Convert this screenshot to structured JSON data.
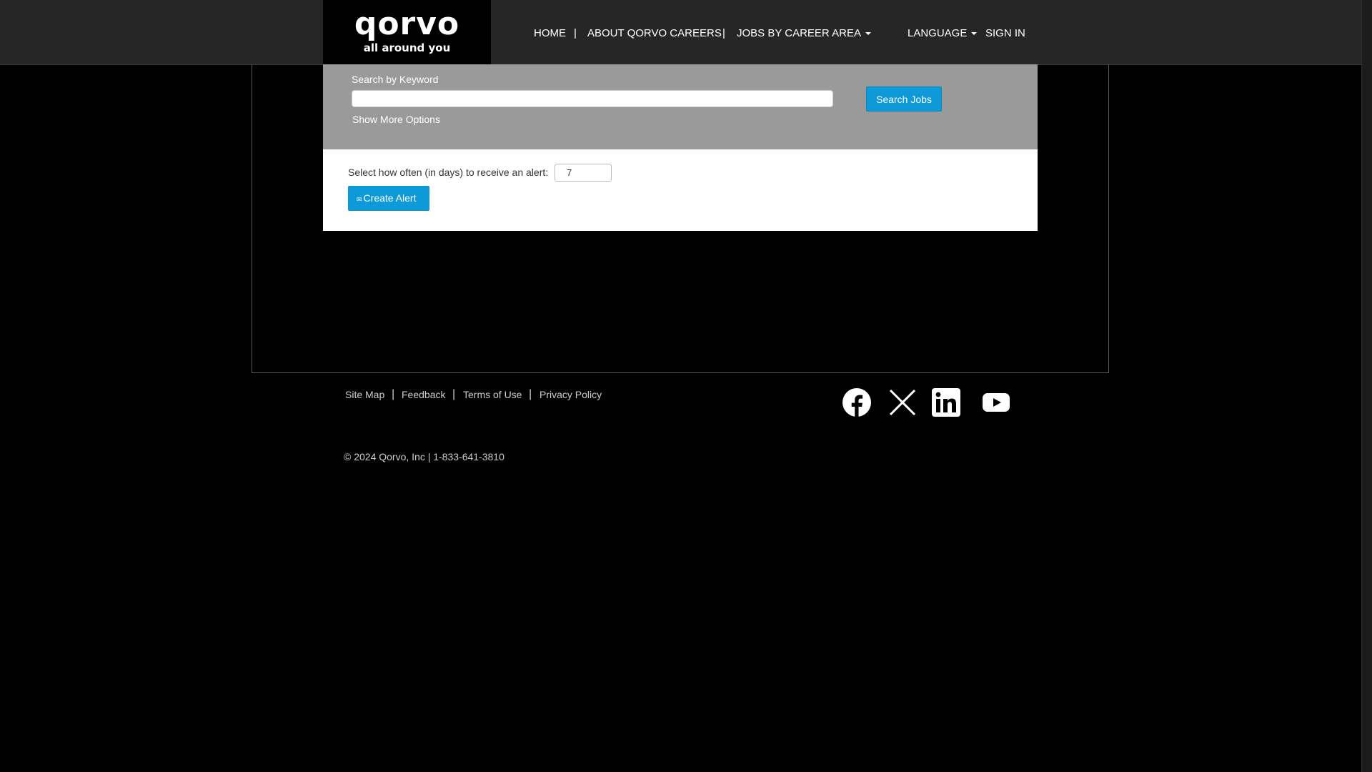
{
  "header": {
    "logo": {
      "wordmark": "qorvo",
      "tagline": "all around you"
    },
    "nav": {
      "home": "HOME",
      "about": "ABOUT QORVO CAREERS",
      "jobs_by_area": "JOBS BY CAREER AREA",
      "language": "LANGUAGE",
      "sign_in": "SIGN IN",
      "separator": "|"
    }
  },
  "search": {
    "keyword_label": "Search by Keyword",
    "keyword_value": "",
    "more_options": "Show More Options",
    "button_label": "Search Jobs"
  },
  "alert": {
    "frequency_label": "Select how often (in days) to receive an alert:",
    "frequency_value": "7",
    "button_label": "Create Alert",
    "button_icon": "envelope-icon"
  },
  "footer": {
    "links": [
      "Site Map",
      "Feedback",
      "Terms of Use",
      "Privacy Policy"
    ],
    "separator": "|",
    "copyright": "© 2024 Qorvo, Inc | 1-833-641-3810",
    "social_icons": [
      "facebook-icon",
      "x-icon",
      "linkedin-icon",
      "youtube-icon"
    ]
  },
  "colors": {
    "accent": "#0e9ad8",
    "topbar": "#262626",
    "search_panel": "#9a9a9a",
    "background": "#000000"
  }
}
